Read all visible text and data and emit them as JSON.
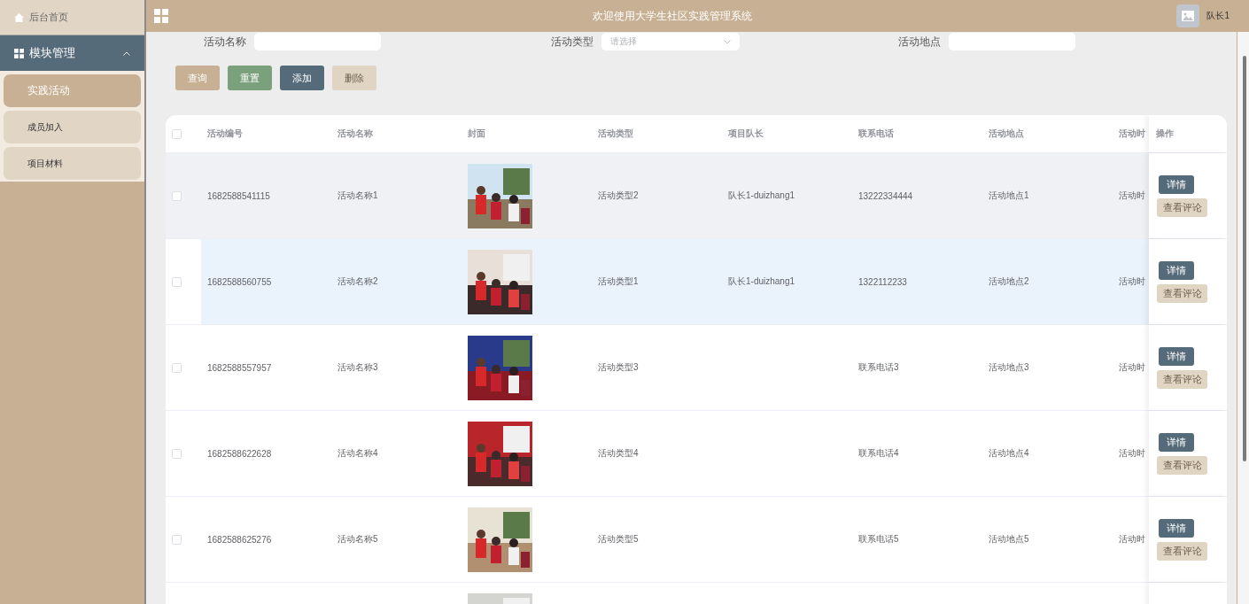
{
  "header": {
    "title": "欢迎使用大学生社区实践管理系统",
    "user": "队长1"
  },
  "sidebar": {
    "home": {
      "label": "后台首页"
    },
    "menu": {
      "label": "模块管理",
      "expanded": true,
      "items": [
        {
          "label": "实践活动",
          "selected": true
        },
        {
          "label": "成员加入",
          "selected": false
        },
        {
          "label": "项目材料",
          "selected": false
        }
      ]
    }
  },
  "search": {
    "fields": [
      {
        "label": "活动名称",
        "kind": "input"
      },
      {
        "label": "活动类型",
        "kind": "select",
        "placeholder": "请选择"
      },
      {
        "label": "活动地点",
        "kind": "input"
      }
    ]
  },
  "buttons": [
    {
      "label": "查询",
      "color": "#c8b094",
      "disabled": false
    },
    {
      "label": "重置",
      "color": "#7aa17c",
      "disabled": false
    },
    {
      "label": "添加",
      "color": "#566b7a",
      "disabled": false
    },
    {
      "label": "删除",
      "color": "#e0d4c2",
      "disabled": true
    }
  ],
  "table": {
    "all_checked": false,
    "columns": [
      "活动编号",
      "活动名称",
      "封面",
      "活动类型",
      "项目队长",
      "联系电话",
      "活动地点",
      "活动时",
      "操作"
    ],
    "rows": [
      {
        "hovered": true,
        "selected": false,
        "checked": false,
        "id": "1682588541115",
        "name": "活动名称1",
        "cover": {
          "kind": "picture"
        },
        "type": "活动类型2",
        "leader": "队长1-duizhang1",
        "phone": "13222334444",
        "place": "活动地点1",
        "time": "活动时",
        "actions": [
          "详情",
          "查看评论"
        ]
      },
      {
        "hovered": false,
        "selected": true,
        "checked": false,
        "id": "1682588560755",
        "name": "活动名称2",
        "cover": {
          "kind": "picture"
        },
        "type": "活动类型1",
        "leader": "队长1-duizhang1",
        "phone": "1322112233",
        "place": "活动地点2",
        "time": "活动时",
        "actions": [
          "详情",
          "查看评论"
        ]
      },
      {
        "hovered": false,
        "selected": false,
        "checked": false,
        "id": "1682588557957",
        "name": "活动名称3",
        "cover": {
          "kind": "picture"
        },
        "type": "活动类型3",
        "phone": "联系电话3",
        "place": "活动地点3",
        "time": "活动时",
        "actions": [
          "详情",
          "查看评论"
        ]
      },
      {
        "hovered": false,
        "selected": false,
        "checked": false,
        "id": "1682588622628",
        "name": "活动名称4",
        "cover": {
          "kind": "picture"
        },
        "type": "活动类型4",
        "phone": "联系电话4",
        "place": "活动地点4",
        "time": "活动时",
        "actions": [
          "详情",
          "查看评论"
        ]
      },
      {
        "hovered": false,
        "selected": false,
        "checked": false,
        "id": "1682588625276",
        "name": "活动名称5",
        "cover": {
          "kind": "picture"
        },
        "type": "活动类型5",
        "phone": "联系电话5",
        "place": "活动地点5",
        "time": "活动时",
        "actions": [
          "详情",
          "查看评论"
        ]
      },
      {
        "hovered": false,
        "selected": false,
        "cover": {
          "kind": "picture"
        }
      }
    ]
  }
}
